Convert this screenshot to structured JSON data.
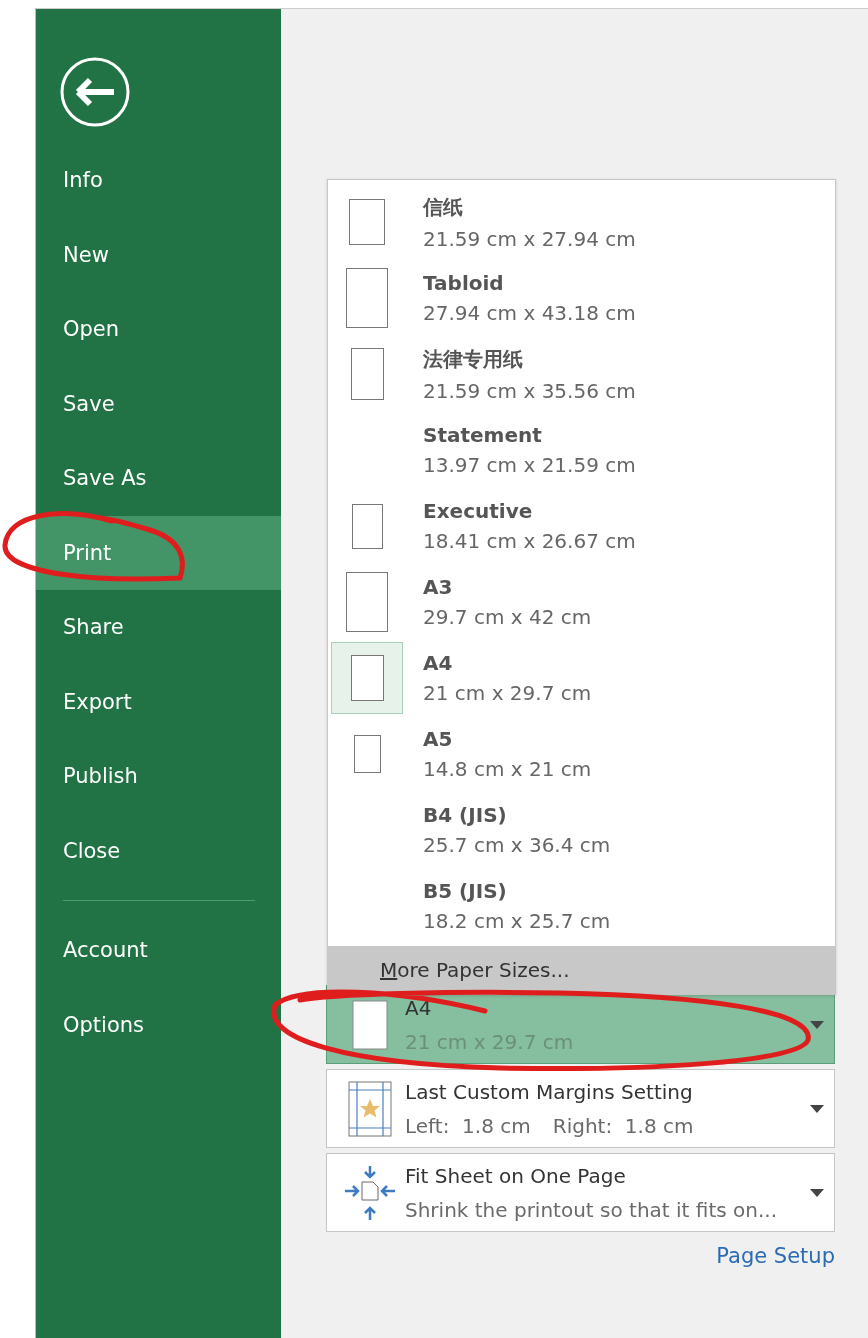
{
  "sidebar": {
    "items": [
      {
        "label": "Info",
        "selected": false
      },
      {
        "label": "New",
        "selected": false
      },
      {
        "label": "Open",
        "selected": false
      },
      {
        "label": "Save",
        "selected": false
      },
      {
        "label": "Save As",
        "selected": false
      },
      {
        "label": "Print",
        "selected": true
      },
      {
        "label": "Share",
        "selected": false
      },
      {
        "label": "Export",
        "selected": false
      },
      {
        "label": "Publish",
        "selected": false
      },
      {
        "label": "Close",
        "selected": false
      }
    ],
    "bottom_items": [
      {
        "label": "Account",
        "selected": false
      },
      {
        "label": "Options",
        "selected": false
      }
    ]
  },
  "paper_menu": {
    "items": [
      {
        "name": "信纸",
        "size": "21.59 cm x 27.94 cm",
        "selected": false
      },
      {
        "name": "Tabloid",
        "size": "27.94 cm x 43.18 cm",
        "selected": false
      },
      {
        "name": "法律专用纸",
        "size": "21.59 cm x 35.56 cm",
        "selected": false
      },
      {
        "name": "Statement",
        "size": "13.97 cm x 21.59 cm",
        "selected": false
      },
      {
        "name": "Executive",
        "size": "18.41 cm x 26.67 cm",
        "selected": false
      },
      {
        "name": "A3",
        "size": "29.7 cm x 42 cm",
        "selected": false
      },
      {
        "name": "A4",
        "size": "21 cm x 29.7 cm",
        "selected": true
      },
      {
        "name": "A5",
        "size": "14.8 cm x 21 cm",
        "selected": false
      },
      {
        "name": "B4 (JIS)",
        "size": "25.7 cm x 36.4 cm",
        "selected": false
      },
      {
        "name": "B5 (JIS)",
        "size": "18.2 cm x 25.7 cm",
        "selected": false
      }
    ],
    "more": "More Paper Sizes..."
  },
  "settings": [
    {
      "kind": "paper",
      "title": "A4",
      "details": [
        "21 cm x 29.7 cm"
      ],
      "open": true
    },
    {
      "kind": "margins",
      "title": "Last Custom Margins Setting",
      "details": [
        "Left:  1.8 cm",
        "Right:  1.8 cm"
      ],
      "open": false
    },
    {
      "kind": "scaling",
      "title": "Fit Sheet on One Page",
      "details": [
        "Shrink the printout so that it fits on..."
      ],
      "open": false
    }
  ],
  "page_setup_link": "Page Setup"
}
